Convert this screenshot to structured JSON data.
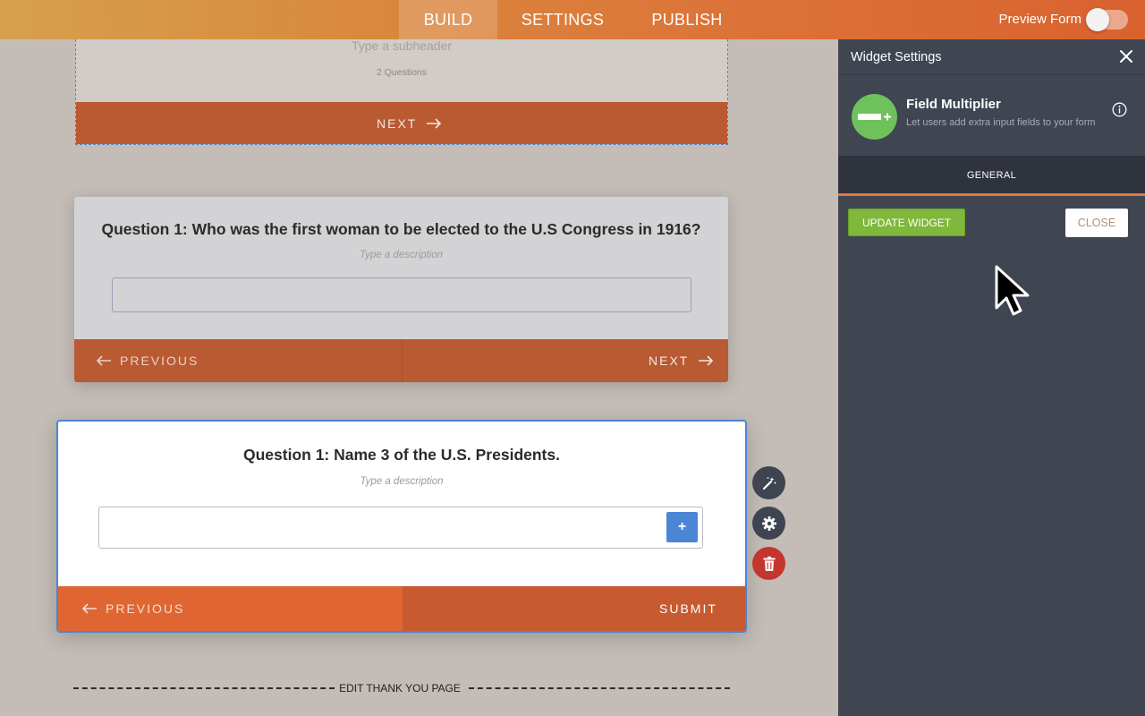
{
  "topbar": {
    "tabs": [
      {
        "label": "BUILD"
      },
      {
        "label": "SETTINGS"
      },
      {
        "label": "PUBLISH"
      }
    ],
    "preview_label": "Preview Form",
    "preview_enabled": false
  },
  "form": {
    "card1": {
      "subheader_placeholder": "Type a subheader",
      "question_count": "2  Questions",
      "next_label": "NEXT"
    },
    "card2": {
      "title": "Question 1: Who was the first woman to be elected to the U.S Congress in 1916?",
      "description_placeholder": "Type a description",
      "previous_label": "PREVIOUS",
      "next_label": "NEXT"
    },
    "card3": {
      "title": "Question 1: Name 3 of the U.S. Presidents.",
      "description_placeholder": "Type a description",
      "add_field_label": "+",
      "previous_label": "PREVIOUS",
      "submit_label": "SUBMIT"
    },
    "tools": [
      "wand-icon",
      "gear-icon",
      "trash-icon"
    ],
    "thank_you_label": "EDIT THANK YOU PAGE"
  },
  "panel": {
    "title": "Widget Settings",
    "widget_name": "Field Multiplier",
    "widget_description": "Let users add extra input fields to your form",
    "tab_label": "GENERAL",
    "update_label": "UPDATE WIDGET",
    "close_label": "CLOSE"
  },
  "colors": {
    "accent_orange": "#dc6a35",
    "selection_blue": "#4a86d4",
    "update_green": "#7fb83a",
    "panel_bg": "#3f4551",
    "delete_red": "#c4362d"
  }
}
